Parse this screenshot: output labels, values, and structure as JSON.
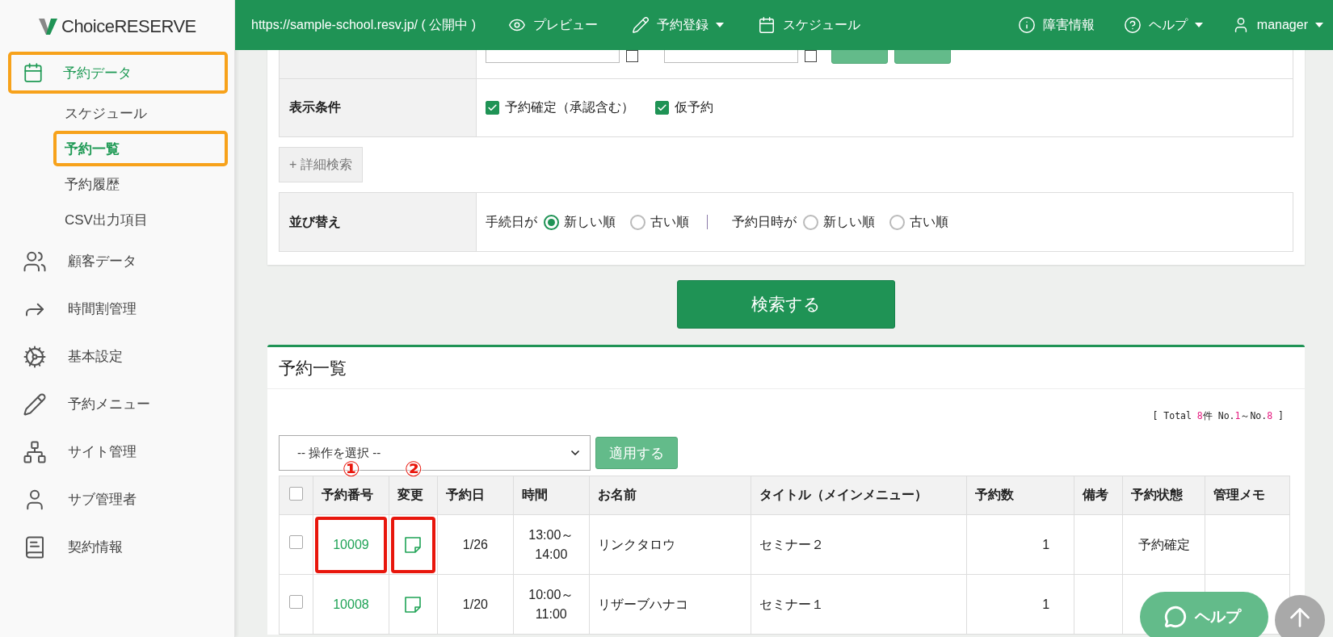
{
  "header": {
    "url": "https://sample-school.resv.jp/ ( 公開中 )",
    "nav": [
      {
        "label": "プレビュー",
        "dropdown": false
      },
      {
        "label": "予約登録",
        "dropdown": true
      },
      {
        "label": "スケジュール",
        "dropdown": false
      }
    ],
    "right_nav": [
      {
        "label": "障害情報",
        "dropdown": false
      },
      {
        "label": "ヘルプ",
        "dropdown": true
      },
      {
        "label": "manager",
        "dropdown": true
      }
    ]
  },
  "sidebar": {
    "logo": "ChoiceRESERVE",
    "items": [
      {
        "label": "予約データ",
        "selected": true,
        "highlighted": true,
        "children": [
          {
            "label": "スケジュール",
            "selected": false,
            "highlighted": false
          },
          {
            "label": "予約一覧",
            "selected": true,
            "highlighted": true
          },
          {
            "label": "予約履歴",
            "selected": false,
            "highlighted": false
          },
          {
            "label": "CSV出力項目",
            "selected": false,
            "highlighted": false
          }
        ]
      },
      {
        "label": "顧客データ",
        "selected": false,
        "highlighted": false
      },
      {
        "label": "時間割管理",
        "selected": false,
        "highlighted": false
      },
      {
        "label": "基本設定",
        "selected": false,
        "highlighted": false
      },
      {
        "label": "予約メニュー",
        "selected": false,
        "highlighted": false
      },
      {
        "label": "サイト管理",
        "selected": false,
        "highlighted": false
      },
      {
        "label": "サブ管理者",
        "selected": false,
        "highlighted": false
      },
      {
        "label": "契約情報",
        "selected": false,
        "highlighted": false
      }
    ]
  },
  "search_form": {
    "rows": [
      {
        "kind": "date_range",
        "checks": [
          false,
          false
        ]
      },
      {
        "kind": "checkboxes",
        "label": "表示条件",
        "options": [
          {
            "label": "予約確定（承認含む）",
            "checked": true
          },
          {
            "label": "仮予約",
            "checked": true
          }
        ]
      },
      {
        "kind": "button",
        "label": "+ 詳細検索"
      },
      {
        "kind": "sort",
        "label": "並び替え",
        "groups": [
          {
            "label": "手続日が",
            "options": [
              {
                "label": "新しい順",
                "selected": true
              },
              {
                "label": "古い順",
                "selected": false
              }
            ]
          },
          {
            "label": "予約日時が",
            "options": [
              {
                "label": "新しい順",
                "selected": false
              },
              {
                "label": "古い順",
                "selected": false
              }
            ]
          }
        ]
      }
    ],
    "submit": "検索する"
  },
  "reservation_list": {
    "title": "予約一覧",
    "summary": [
      {
        "text": "[ Total ",
        "accent": false
      },
      {
        "text": "8",
        "accent": true
      },
      {
        "text": "件 No.",
        "accent": false
      },
      {
        "text": "1",
        "accent": true
      },
      {
        "text": "～No.",
        "accent": false
      },
      {
        "text": "8",
        "accent": true
      },
      {
        "text": " ]",
        "accent": false
      }
    ],
    "bulk_action": {
      "value": "-- 操作を選択 --",
      "apply": "適用する"
    },
    "all_checked": false,
    "columns": [
      {
        "label": "予約番号",
        "annotation": "①"
      },
      {
        "label": "変更",
        "annotation": "②"
      },
      {
        "label": "予約日"
      },
      {
        "label": "時間"
      },
      {
        "label": "お名前"
      },
      {
        "label": "タイトル（メインメニュー）"
      },
      {
        "label": "予約数"
      },
      {
        "label": "備考"
      },
      {
        "label": "予約状態"
      },
      {
        "label": "管理メモ"
      }
    ],
    "rows": [
      {
        "checked": false,
        "number": "10009",
        "number_highlighted": true,
        "edit_highlighted": true,
        "date": "1/26",
        "time": "13:00～\n14:00",
        "name": "リンクタロウ",
        "title": "セミナー２",
        "count": "1",
        "status": "予約確定"
      },
      {
        "checked": false,
        "number": "10008",
        "number_highlighted": false,
        "edit_highlighted": false,
        "date": "1/20",
        "time": "10:00～\n11:00",
        "name": "リザーブハナコ",
        "title": "セミナー１",
        "count": "1"
      }
    ]
  },
  "help_button": {
    "label": "ヘルプ"
  }
}
